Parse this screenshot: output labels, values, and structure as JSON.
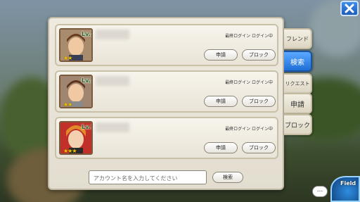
{
  "tabs": [
    {
      "label": "フレンド"
    },
    {
      "label": "検索"
    },
    {
      "label": "リクエスト"
    },
    {
      "label": "申請"
    },
    {
      "label": "ブロック"
    }
  ],
  "results": [
    {
      "level": "Lv.28",
      "stars": "★★",
      "last_login": "最終ログイン ログイン中",
      "apply_label": "申請",
      "block_label": "ブロック"
    },
    {
      "level": "Lv.22",
      "stars": "★★",
      "last_login": "最終ログイン ログイン中",
      "apply_label": "申請",
      "block_label": "ブロック"
    },
    {
      "level": "Lv.15",
      "stars": "★★★",
      "last_login": "最終ログイン ログイン中",
      "apply_label": "申請",
      "block_label": "ブロック"
    }
  ],
  "search": {
    "placeholder": "アカウント名を入力してください",
    "button_label": "検索"
  },
  "chat": {
    "label": "..."
  },
  "field": {
    "label": "Field"
  },
  "colors": {
    "active_tab": "#2f86f0",
    "panel": "#e8e4d8"
  }
}
